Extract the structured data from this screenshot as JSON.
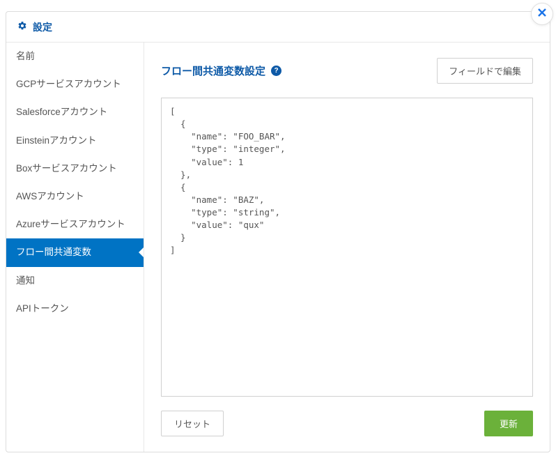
{
  "header": {
    "title": "設定"
  },
  "sidebar": {
    "items": [
      {
        "label": "名前"
      },
      {
        "label": "GCPサービスアカウント"
      },
      {
        "label": "Salesforceアカウント"
      },
      {
        "label": "Einsteinアカウント"
      },
      {
        "label": "Boxサービスアカウント"
      },
      {
        "label": "AWSアカウント"
      },
      {
        "label": "Azureサービスアカウント"
      },
      {
        "label": "フロー間共通変数"
      },
      {
        "label": "通知"
      },
      {
        "label": "APIトークン"
      }
    ],
    "activeIndex": 7
  },
  "content": {
    "title": "フロー間共通変数設定",
    "help_glyph": "?",
    "field_edit_label": "フィールドで編集",
    "editor_value": "[\n  {\n    \"name\": \"FOO_BAR\",\n    \"type\": \"integer\",\n    \"value\": 1\n  },\n  {\n    \"name\": \"BAZ\",\n    \"type\": \"string\",\n    \"value\": \"qux\"\n  }\n]",
    "reset_label": "リセット",
    "update_label": "更新"
  }
}
